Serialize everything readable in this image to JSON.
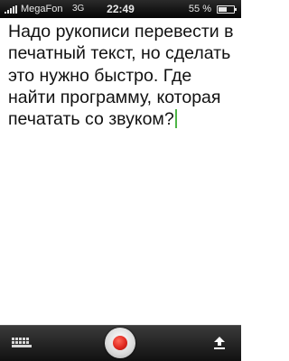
{
  "status_bar": {
    "carrier": "MegaFon",
    "network": "3G",
    "time": "22:49",
    "battery_percent": "55 %",
    "battery_level": 0.55
  },
  "editor": {
    "text": "Надо рукописи перевести в печатный текст, но сделать это нужно быстро. Где найти программу, которая печатать со звуком?"
  },
  "toolbar": {
    "icons": [
      "keyboard-icon",
      "record-icon",
      "share-icon"
    ],
    "record_color": "#e0281f"
  }
}
